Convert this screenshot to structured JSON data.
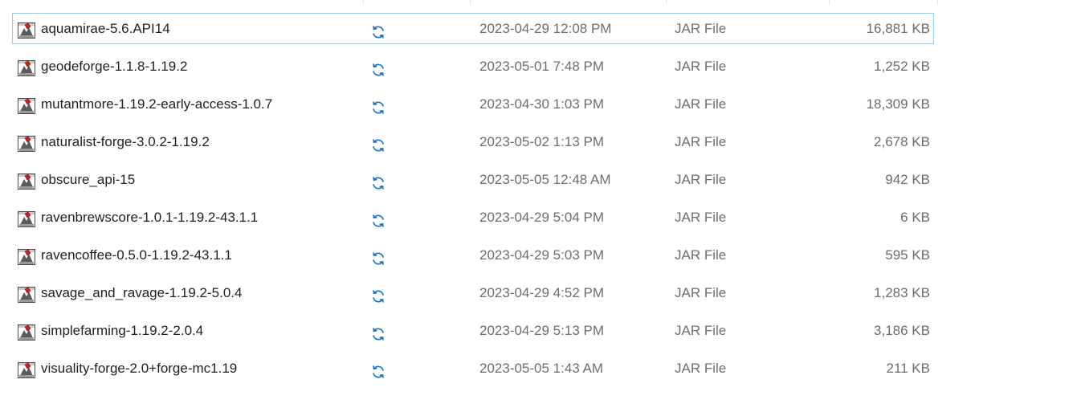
{
  "files": [
    {
      "name": "aquamirae-5.6.API14",
      "date": "2023-04-29 12:08 PM",
      "type": "JAR File",
      "size": "16,881 KB",
      "icon": "jar-file-icon",
      "status_icon": "sync-icon",
      "focused": true
    },
    {
      "name": "geodeforge-1.1.8-1.19.2",
      "date": "2023-05-01 7:48 PM",
      "type": "JAR File",
      "size": "1,252 KB",
      "icon": "jar-file-icon",
      "status_icon": "sync-icon"
    },
    {
      "name": "mutantmore-1.19.2-early-access-1.0.7",
      "date": "2023-04-30 1:03 PM",
      "type": "JAR File",
      "size": "18,309 KB",
      "icon": "jar-file-icon",
      "status_icon": "sync-icon"
    },
    {
      "name": "naturalist-forge-3.0.2-1.19.2",
      "date": "2023-05-02 1:13 PM",
      "type": "JAR File",
      "size": "2,678 KB",
      "icon": "jar-file-icon",
      "status_icon": "sync-icon"
    },
    {
      "name": "obscure_api-15",
      "date": "2023-05-05 12:48 AM",
      "type": "JAR File",
      "size": "942 KB",
      "icon": "jar-file-icon",
      "status_icon": "sync-icon"
    },
    {
      "name": "ravenbrewscore-1.0.1-1.19.2-43.1.1",
      "date": "2023-04-29 5:04 PM",
      "type": "JAR File",
      "size": "6 KB",
      "icon": "jar-file-icon",
      "status_icon": "sync-icon"
    },
    {
      "name": "ravencoffee-0.5.0-1.19.2-43.1.1",
      "date": "2023-04-29 5:03 PM",
      "type": "JAR File",
      "size": "595 KB",
      "icon": "jar-file-icon",
      "status_icon": "sync-icon"
    },
    {
      "name": "savage_and_ravage-1.19.2-5.0.4",
      "date": "2023-04-29 4:52 PM",
      "type": "JAR File",
      "size": "1,283 KB",
      "icon": "jar-file-icon",
      "status_icon": "sync-icon"
    },
    {
      "name": "simplefarming-1.19.2-2.0.4",
      "date": "2023-04-29 5:13 PM",
      "type": "JAR File",
      "size": "3,186 KB",
      "icon": "jar-file-icon",
      "status_icon": "sync-icon"
    },
    {
      "name": "visuality-forge-2.0+forge-mc1.19",
      "date": "2023-05-05 1:43 AM",
      "type": "JAR File",
      "size": "211 KB",
      "icon": "jar-file-icon",
      "status_icon": "sync-icon"
    }
  ],
  "colors": {
    "focus_border": "#99c9ef",
    "sync_blue": "#1a73c8",
    "secondary_text": "#6d6d6d",
    "primary_text": "#1f1f1f"
  }
}
